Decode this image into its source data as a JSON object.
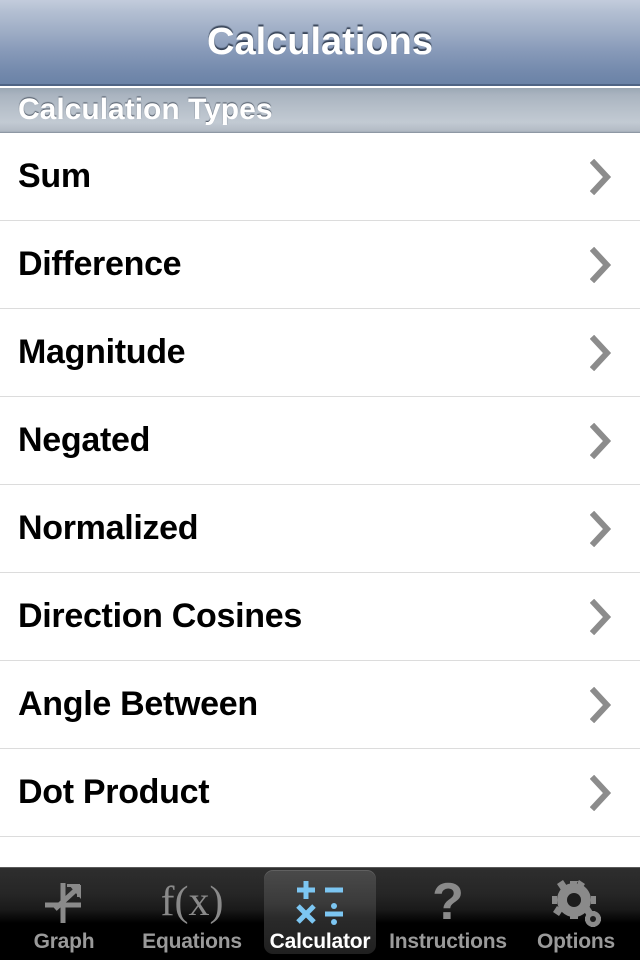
{
  "navbar": {
    "title": "Calculations"
  },
  "section": {
    "header": "Calculation Types"
  },
  "list": {
    "rows": [
      {
        "label": "Sum",
        "accessory": "chevron-right-icon"
      },
      {
        "label": "Difference",
        "accessory": "chevron-right-icon"
      },
      {
        "label": "Magnitude",
        "accessory": "chevron-right-icon"
      },
      {
        "label": "Negated",
        "accessory": "chevron-right-icon"
      },
      {
        "label": "Normalized",
        "accessory": "chevron-right-icon"
      },
      {
        "label": "Direction Cosines",
        "accessory": "chevron-right-icon"
      },
      {
        "label": "Angle Between",
        "accessory": "chevron-right-icon"
      },
      {
        "label": "Dot Product",
        "accessory": "chevron-right-icon"
      }
    ]
  },
  "tabbar": {
    "selected_index": 2,
    "tabs": [
      {
        "label": "Graph",
        "icon": "graph-axes-arrow-icon"
      },
      {
        "label": "Equations",
        "icon": "function-fx-icon"
      },
      {
        "label": "Calculator",
        "icon": "calculator-operators-icon"
      },
      {
        "label": "Instructions",
        "icon": "question-mark-icon"
      },
      {
        "label": "Options",
        "icon": "gears-icon"
      }
    ]
  },
  "colors": {
    "navbar_accent": "#7389ac",
    "selected_tab_icon": "#6ec0f0",
    "tab_label_inactive": "#9a9a9a",
    "tab_label_active": "#ffffff",
    "chevron": "#8c8c8c",
    "row_separator": "#dcdcdc"
  }
}
